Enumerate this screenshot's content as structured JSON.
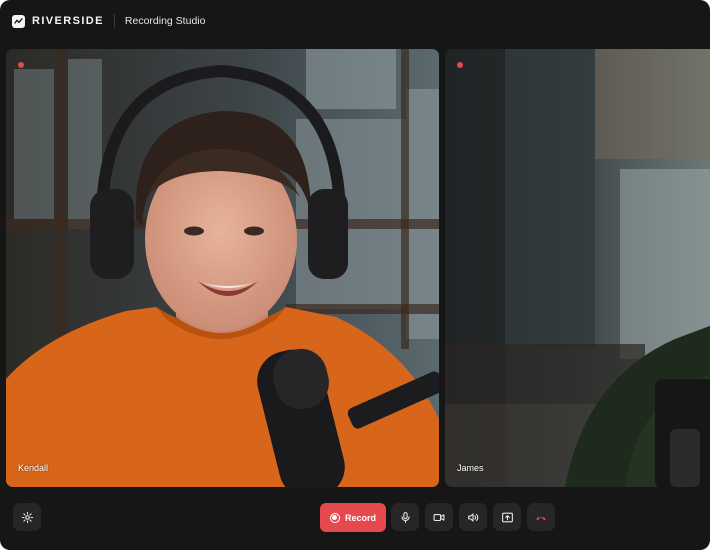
{
  "header": {
    "brand": "RIVERSIDE",
    "title": "Recording Studio"
  },
  "participants": [
    {
      "name": "Kendall",
      "recording": true
    },
    {
      "name": "James",
      "recording": true
    }
  ],
  "toolbar": {
    "record_label": "Record"
  },
  "colors": {
    "background": "#161616",
    "accent_red": "#e5484d",
    "button_bg": "#262626",
    "text": "#f2f2f2"
  },
  "icons": [
    "riverside-logo-icon",
    "recording-dot-icon",
    "settings-gear-icon",
    "record-icon",
    "microphone-icon",
    "camera-icon",
    "speaker-icon",
    "share-screen-icon",
    "hang-up-icon"
  ]
}
